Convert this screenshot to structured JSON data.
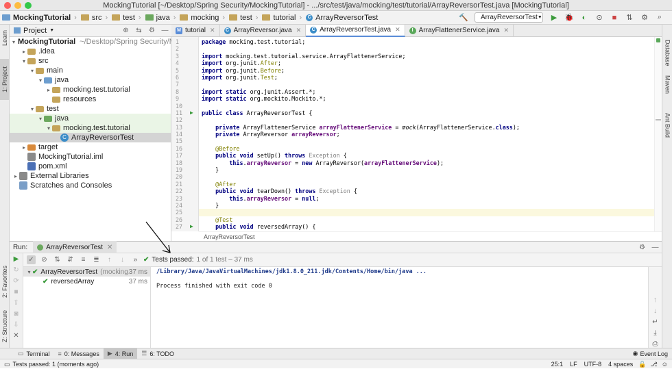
{
  "window": {
    "title": "MockingTutorial [~/Desktop/Spring Security/MockingTutorial] - .../src/test/java/mocking/test/tutorial/ArrayReversorTest.java [MockingTutorial]"
  },
  "navbar": {
    "breadcrumbs": [
      "MockingTutorial",
      "src",
      "test",
      "java",
      "mocking",
      "test",
      "tutorial",
      "ArrayReversorTest"
    ],
    "run_config": "ArrayReversorTest"
  },
  "left_strip": {
    "learn": "Learn",
    "project": "1: Project",
    "favorites": "2: Favorites",
    "structure": "Z: Structure"
  },
  "right_strip": {
    "database": "Database",
    "maven": "Maven",
    "ant": "Ant Build"
  },
  "project_panel": {
    "title": "Project",
    "tree": [
      {
        "label": "MockingTutorial",
        "suffix": "~/Desktop/Spring Security/Mo",
        "depth": 0,
        "arrow": "▾",
        "icon": "folder-blue",
        "bold": true
      },
      {
        "label": ".idea",
        "depth": 1,
        "arrow": "▸",
        "icon": "folder"
      },
      {
        "label": "src",
        "depth": 1,
        "arrow": "▾",
        "icon": "folder"
      },
      {
        "label": "main",
        "depth": 2,
        "arrow": "▾",
        "icon": "folder"
      },
      {
        "label": "java",
        "depth": 3,
        "arrow": "▾",
        "icon": "folder-blue"
      },
      {
        "label": "mocking.test.tutorial",
        "depth": 4,
        "arrow": "▸",
        "icon": "folder"
      },
      {
        "label": "resources",
        "depth": 4,
        "arrow": "",
        "icon": "folder"
      },
      {
        "label": "test",
        "depth": 2,
        "arrow": "▾",
        "icon": "folder"
      },
      {
        "label": "java",
        "depth": 3,
        "arrow": "▾",
        "icon": "folder-green",
        "green": true
      },
      {
        "label": "mocking.test.tutorial",
        "depth": 4,
        "arrow": "▾",
        "icon": "folder",
        "green": true
      },
      {
        "label": "ArrayReversorTest",
        "depth": 5,
        "arrow": "",
        "icon": "class",
        "selected": true
      },
      {
        "label": "target",
        "depth": 1,
        "arrow": "▸",
        "icon": "folder-orange"
      },
      {
        "label": "MockingTutorial.iml",
        "depth": 1,
        "arrow": "",
        "icon": "file"
      },
      {
        "label": "pom.xml",
        "depth": 1,
        "arrow": "",
        "icon": "maven"
      },
      {
        "label": "External Libraries",
        "depth": 0,
        "arrow": "▸",
        "icon": "lib"
      },
      {
        "label": "Scratches and Consoles",
        "depth": 0,
        "arrow": "",
        "icon": "scratch"
      }
    ]
  },
  "editor_tabs": [
    {
      "label": "tutorial",
      "icon": "m",
      "active": false
    },
    {
      "label": "ArrayReversor.java",
      "icon": "c",
      "active": false
    },
    {
      "label": "ArrayReversorTest.java",
      "icon": "c",
      "active": true
    },
    {
      "label": "ArrayFlattenerService.java",
      "icon": "i",
      "active": false
    }
  ],
  "code_lines": [
    {
      "n": "1",
      "html": "<span class=\"kw\">package</span> mocking.test.tutorial;"
    },
    {
      "n": "2",
      "html": ""
    },
    {
      "n": "3",
      "html": "<span class=\"kw\">import</span> mocking.test.tutorial.service.ArrayFlattenerService;"
    },
    {
      "n": "4",
      "html": "<span class=\"kw\">import</span> org.junit.<span class=\"an\">After</span>;"
    },
    {
      "n": "5",
      "html": "<span class=\"kw\">import</span> org.junit.<span class=\"an\">Before</span>;"
    },
    {
      "n": "6",
      "html": "<span class=\"kw\">import</span> org.junit.<span class=\"an\">Test</span>;"
    },
    {
      "n": "7",
      "html": ""
    },
    {
      "n": "8",
      "html": "<span class=\"kw\">import static</span> org.junit.Assert.*;"
    },
    {
      "n": "9",
      "html": "<span class=\"kw\">import static</span> org.mockito.Mockito.*;"
    },
    {
      "n": "10",
      "html": ""
    },
    {
      "n": "11",
      "html": "<span class=\"kw\">public class</span> ArrayReversorTest {",
      "run": true
    },
    {
      "n": "12",
      "html": ""
    },
    {
      "n": "13",
      "html": "    <span class=\"kw\">private</span> ArrayFlattenerService <span class=\"fd\">arrayFlattenerService</span> = <span class=\"it\">mock</span>(ArrayFlattenerService.<span class=\"kw\">class</span>);"
    },
    {
      "n": "14",
      "html": "    <span class=\"kw\">private</span> ArrayReversor <span class=\"fd\">arrayReversor</span>;"
    },
    {
      "n": "15",
      "html": ""
    },
    {
      "n": "16",
      "html": "    <span class=\"an\">@Before</span>"
    },
    {
      "n": "17",
      "html": "    <span class=\"kw\">public void</span> setUp() <span class=\"kw\">throws</span> <span class=\"gi\">Exception</span> {"
    },
    {
      "n": "18",
      "html": "        <span class=\"kw\">this</span>.<span class=\"fd\">arrayReversor</span> = <span class=\"kw\">new</span> ArrayReversor(<span class=\"fd\">arrayFlattenerService</span>);"
    },
    {
      "n": "19",
      "html": "    }"
    },
    {
      "n": "20",
      "html": ""
    },
    {
      "n": "21",
      "html": "    <span class=\"an\">@After</span>"
    },
    {
      "n": "22",
      "html": "    <span class=\"kw\">public void</span> tearDown() <span class=\"kw\">throws</span> <span class=\"gi\">Exception</span> {"
    },
    {
      "n": "23",
      "html": "        <span class=\"kw\">this</span>.<span class=\"fd\">arrayReversor</span> = <span class=\"kw\">null</span>;"
    },
    {
      "n": "24",
      "html": "    }"
    },
    {
      "n": "25",
      "html": "",
      "hl": true
    },
    {
      "n": "26",
      "html": "    <span class=\"an\">@Test</span>"
    },
    {
      "n": "27",
      "html": "    <span class=\"kw\">public void</span> reversedArray() {",
      "run": true
    }
  ],
  "editor_breadcrumb": "ArrayReversorTest",
  "run_panel": {
    "label": "Run:",
    "tab": "ArrayReversorTest",
    "status": "Tests passed:",
    "status_detail": "1 of 1 test – 37 ms",
    "tests": [
      {
        "label": "ArrayReversorTest",
        "suffix": "(mocking.t",
        "time": "37 ms",
        "depth": 0
      },
      {
        "label": "reversedArray",
        "suffix": "",
        "time": "37 ms",
        "depth": 1
      }
    ],
    "console": [
      "/Library/Java/JavaVirtualMachines/jdk1.8.0_211.jdk/Contents/Home/bin/java ...",
      "",
      "Process finished with exit code 0"
    ]
  },
  "bottom_tabs": [
    {
      "label": "Terminal",
      "icon": "▭",
      "active": false
    },
    {
      "label": "0: Messages",
      "icon": "≡",
      "active": false
    },
    {
      "label": "4: Run",
      "icon": "▶",
      "active": true
    },
    {
      "label": "6: TODO",
      "icon": "☰",
      "active": false
    }
  ],
  "event_log": "Event Log",
  "statusbar": {
    "message": "Tests passed: 1 (moments ago)",
    "position": "25:1",
    "line_sep": "LF",
    "encoding": "UTF-8",
    "indent": "4 spaces"
  }
}
